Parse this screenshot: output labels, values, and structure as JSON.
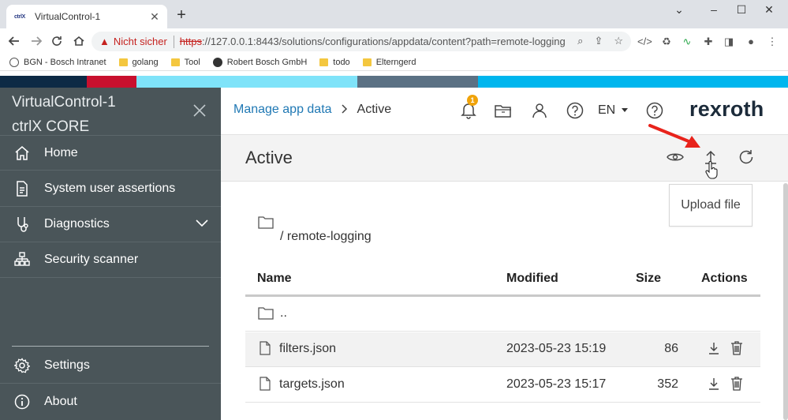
{
  "browser": {
    "tab_title": "VirtualControl-1",
    "tab_favicon_text": "ctrlX",
    "not_secure_label": "Nicht sicher",
    "url_protocol": "https",
    "url_rest": "://127.0.0.1:8443/solutions/configurations/appdata/content?path=remote-logging",
    "bookmarks": [
      {
        "label": "BGN - Bosch Intranet"
      },
      {
        "label": "golang"
      },
      {
        "label": "Tool"
      },
      {
        "label": "Robert Bosch GmbH"
      },
      {
        "label": "todo"
      },
      {
        "label": "Elterngerd"
      }
    ]
  },
  "band_colors": [
    "#0d2a45",
    "#c8102e",
    "#7fe3f9",
    "#5b7184",
    "#00b6ee"
  ],
  "sidebar": {
    "title_line1": "VirtualControl-1",
    "title_line2": "ctrlX CORE",
    "items": [
      {
        "label": "Home",
        "icon": "home-icon"
      },
      {
        "label": "System user assertions",
        "icon": "document-icon"
      },
      {
        "label": "Diagnostics",
        "icon": "diagnostics-icon"
      },
      {
        "label": "Security scanner",
        "icon": "scanner-icon"
      }
    ],
    "bottom_items": [
      {
        "label": "Settings",
        "icon": "gear-icon"
      },
      {
        "label": "About",
        "icon": "info-icon"
      }
    ]
  },
  "header": {
    "breadcrumb_link": "Manage app data",
    "breadcrumb_current": "Active",
    "notification_count": "1",
    "language": "EN",
    "brand": "rexroth"
  },
  "page": {
    "title": "Active",
    "upload_tooltip": "Upload file",
    "path": "/ remote-logging"
  },
  "table": {
    "columns": {
      "name": "Name",
      "modified": "Modified",
      "size": "Size",
      "actions": "Actions"
    },
    "parent_row": "..",
    "rows": [
      {
        "name": "filters.json",
        "modified": "2023-05-23 15:19",
        "size": "86"
      },
      {
        "name": "targets.json",
        "modified": "2023-05-23 15:17",
        "size": "352"
      }
    ]
  },
  "colors": {
    "sidebar_bg": "#4a5559",
    "link": "#1f78b4",
    "badge": "#f0a30a",
    "arrow": "#e8231b"
  }
}
